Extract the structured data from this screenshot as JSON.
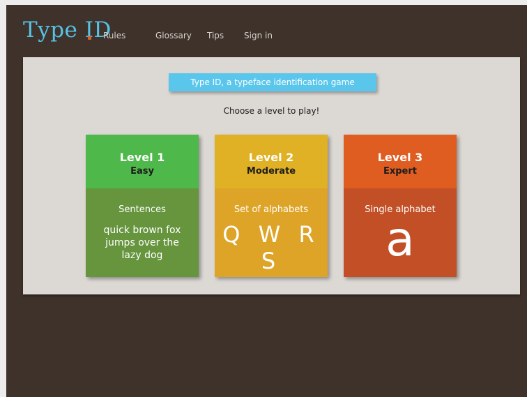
{
  "logo": {
    "text_type": "Type",
    "text_id_i": "I",
    "text_id_dot": "",
    "text_id_d": "D"
  },
  "nav": {
    "items": [
      "Rules",
      "Glossary",
      "Tips",
      "Sign in"
    ]
  },
  "banner": {
    "title": "Type ID, a typeface identification game"
  },
  "subtitle": "Choose a level to play!",
  "levels": [
    {
      "level": "Level 1",
      "difficulty": "Easy",
      "type": "Sentences",
      "sample": "quick brown fox jumps over the lazy dog",
      "head_color": "#4fb84b",
      "body_color": "#66953e"
    },
    {
      "level": "Level 2",
      "difficulty": "Moderate",
      "type": "Set of alphabets",
      "sample": "Q W R S",
      "head_color": "#e0b025",
      "body_color": "#dea428"
    },
    {
      "level": "Level 3",
      "difficulty": "Expert",
      "type": "Single alphabet",
      "sample": "a",
      "head_color": "#e05d22",
      "body_color": "#c24f25"
    }
  ]
}
